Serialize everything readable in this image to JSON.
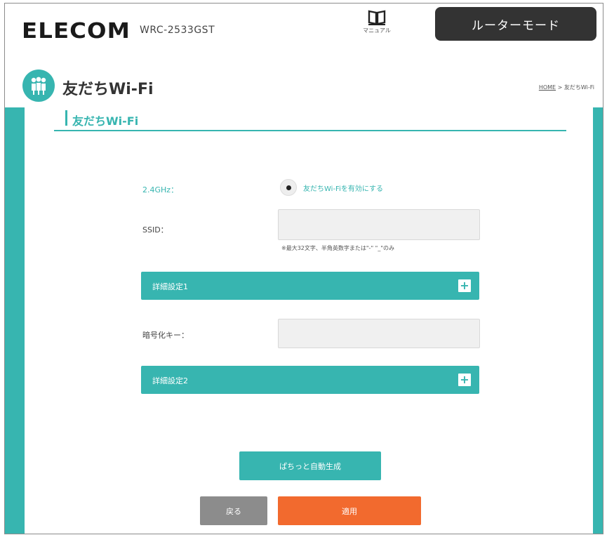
{
  "header": {
    "brand": "ELECOM",
    "model": "WRC-2533GST",
    "manual_label": "マニュアル",
    "mode_label": "ルーターモード"
  },
  "page": {
    "title": "友だちWi-Fi",
    "breadcrumb_home": "HOME",
    "breadcrumb_sep": " > ",
    "breadcrumb_current": "友だちWi-Fi"
  },
  "section": {
    "title": "友だちWi-Fi"
  },
  "form": {
    "band_label": "2.4GHz：",
    "enable_label": "友だちWi-Fiを有効にする",
    "enable_selected": true,
    "ssid_label": "SSID：",
    "ssid_value": "",
    "ssid_hint": "※最大32文字、半角英数字または\"-\" \"_\"のみ",
    "advanced1_label": "詳細設定1",
    "key_label": "暗号化キー：",
    "key_value": "",
    "advanced2_label": "詳細設定2",
    "expand_symbol": "+"
  },
  "buttons": {
    "auto_generate": "ぱちっと自動生成",
    "back": "戻る",
    "apply": "適用"
  },
  "colors": {
    "accent": "#37b5b0",
    "header_dark": "#333333",
    "apply": "#f26a2e",
    "back": "#8c8c8c"
  }
}
